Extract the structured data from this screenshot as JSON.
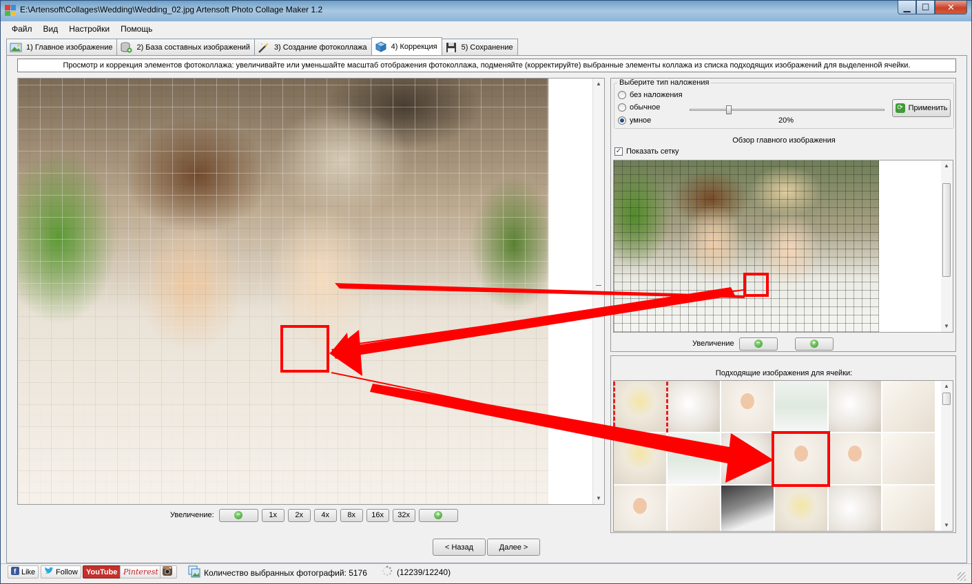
{
  "window": {
    "title": "E:\\Artensoft\\Collages\\Wedding\\Wedding_02.jpg Artensoft Photo Collage Maker 1.2"
  },
  "menu": [
    "Файл",
    "Вид",
    "Настройки",
    "Помощь"
  ],
  "tabs": [
    {
      "label": "1) Главное изображение",
      "icon": "landscape-image-icon"
    },
    {
      "label": "2) База составных изображений",
      "icon": "database-icon"
    },
    {
      "label": "3) Создание фотоколлажа",
      "icon": "magic-wand-icon"
    },
    {
      "label": "4) Коррекция",
      "icon": "cube-icon",
      "active": true
    },
    {
      "label": "5) Сохранение",
      "icon": "floppy-disk-icon"
    }
  ],
  "info_text": "Просмотр и коррекция элементов фотоколлажа: увеличивайте или уменьшайте масштаб отображения фотоколлажа, подменяйте (корректируйте) выбранные элементы коллажа из списка подходящих изображений для выделенной ячейки.",
  "zoom": {
    "label": "Увеличение:",
    "levels": [
      "1x",
      "2x",
      "4x",
      "8x",
      "16x",
      "32x"
    ]
  },
  "overlay": {
    "group_title": "Выберите тип наложения",
    "options": [
      "без наложения",
      "обычное",
      "умное"
    ],
    "selected_index": 2,
    "slider_value": "20%",
    "slider_fraction": 0.2,
    "apply_label": "Применить"
  },
  "preview": {
    "title": "Обзор главного изображения",
    "show_grid_label": "Показать сетку",
    "show_grid_checked": true,
    "zoom_label": "Увеличение"
  },
  "matching": {
    "title": "Подходящие изображения для ячейки:"
  },
  "nav": {
    "back": "< Назад",
    "next": "Далее >"
  },
  "status": {
    "like": "Like",
    "follow": "Follow",
    "youtube": "YouTube",
    "pinterest": "Pinterest",
    "selected_count": "Количество выбранных фотографий: 5176",
    "progress": "(12239/12240)"
  },
  "colors": {
    "highlight": "#ff0000",
    "accent_green": "#3f9b36",
    "title_bar": "#8cb4d6"
  }
}
